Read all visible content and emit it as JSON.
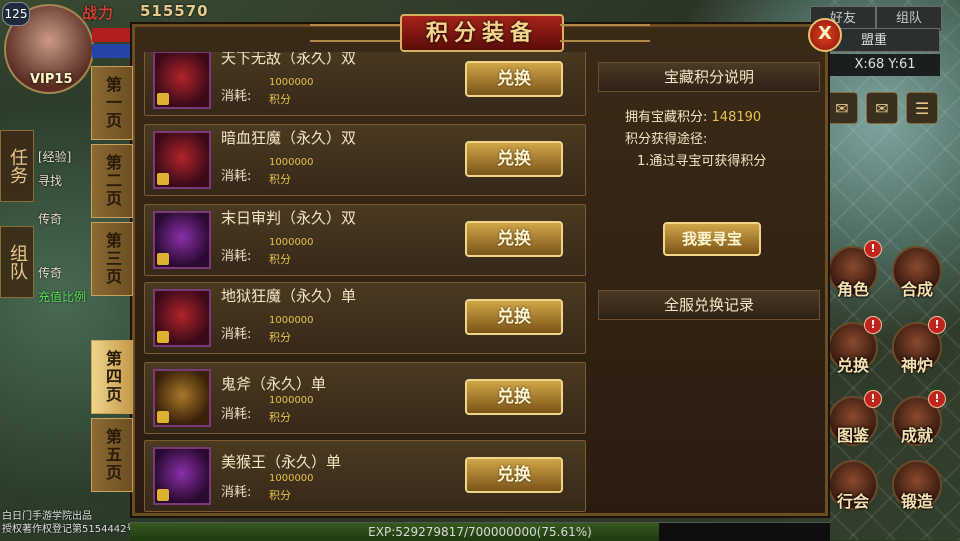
{
  "hud": {
    "level": "125",
    "vip": "VIP15",
    "power_label": "战力",
    "power_value": "515570"
  },
  "left_panel": {
    "tab_quest": "任务",
    "tab_team": "组队",
    "lines": [
      "[经验]",
      "寻找",
      "传奇",
      "传奇",
      "充值比例"
    ],
    "copyright": [
      "白日门手游学院出品",
      "授权著作权登记第5154442号"
    ]
  },
  "social": {
    "friends": "好友",
    "team": "组队",
    "guild": "盟重",
    "coords": "X:68 Y:61"
  },
  "right_menu": [
    {
      "label": "角色",
      "alert": "!"
    },
    {
      "label": "合成",
      "alert": ""
    },
    {
      "label": "兑换",
      "alert": "!"
    },
    {
      "label": "神炉",
      "alert": "!"
    },
    {
      "label": "图鉴",
      "alert": "!"
    },
    {
      "label": "成就",
      "alert": "!"
    },
    {
      "label": "行会",
      "alert": ""
    },
    {
      "label": "锻造",
      "alert": ""
    }
  ],
  "exp": {
    "text": "EXP:529279817/700000000(75.61%)",
    "fraction": 0.7561
  },
  "panel": {
    "title": "积分装备",
    "close": "X",
    "pages": [
      "第一页",
      "第二页",
      "第三页",
      "第四页",
      "第五页"
    ],
    "active_page": 3,
    "items": [
      {
        "name": "天下无敌（永久）双",
        "cost_label": "消耗:",
        "cost": "1000000",
        "unit": "积分",
        "button": "兑换",
        "icon": "red"
      },
      {
        "name": "暗血狂魔（永久）双",
        "cost_label": "消耗:",
        "cost": "1000000",
        "unit": "积分",
        "button": "兑换",
        "icon": "red"
      },
      {
        "name": "末日审判（永久）双",
        "cost_label": "消耗:",
        "cost": "1000000",
        "unit": "积分",
        "button": "兑换",
        "icon": "purple"
      },
      {
        "name": "地狱狂魔（永久）单",
        "cost_label": "消耗:",
        "cost": "1000000",
        "unit": "积分",
        "button": "兑换",
        "icon": "red"
      },
      {
        "name": "鬼斧（永久）单",
        "cost_label": "消耗:",
        "cost": "1000000",
        "unit": "积分",
        "button": "兑换",
        "icon": "gold"
      },
      {
        "name": "美猴王（永久）单",
        "cost_label": "消耗:",
        "cost": "1000000",
        "unit": "积分",
        "button": "兑换",
        "icon": "purple"
      }
    ],
    "info": {
      "header": "宝藏积分说明",
      "points_label": "拥有宝藏积分:",
      "points_value": "148190",
      "source_label": "积分获得途径:",
      "source_1": "1.通过寻宝可获得积分",
      "hunt_button": "我要寻宝",
      "records_header": "全服兑换记录"
    }
  },
  "colors": {
    "gold": "#e7c24a",
    "panel_bg": "#2a1d10",
    "title_red": "#a6241a"
  }
}
